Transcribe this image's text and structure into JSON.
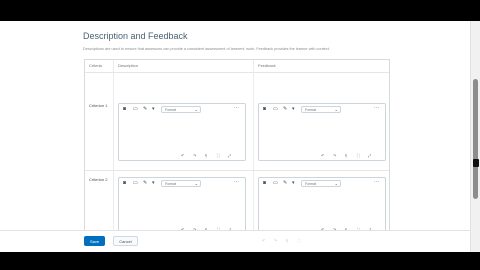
{
  "section": {
    "title": "Description and Feedback",
    "description": "Descriptions are used to ensure that assessors can provide a consistent assessment of learners' work. Feedback provides the learner with context."
  },
  "table": {
    "headers": [
      "Criteria",
      "Description",
      "Feedback"
    ],
    "rows": [
      {
        "criterion": "Criterion 1"
      },
      {
        "criterion": "Criterion 2"
      }
    ]
  },
  "editor": {
    "format_label": "Format",
    "icons": [
      "insert-image-icon",
      "insert-media-icon",
      "insert-link-icon"
    ],
    "status_icons": [
      "undo-icon",
      "redo-icon",
      "word-count-icon",
      "fullscreen-icon",
      "expand-icon"
    ]
  },
  "footer": {
    "save_label": "Save",
    "cancel_label": "Cancel"
  }
}
